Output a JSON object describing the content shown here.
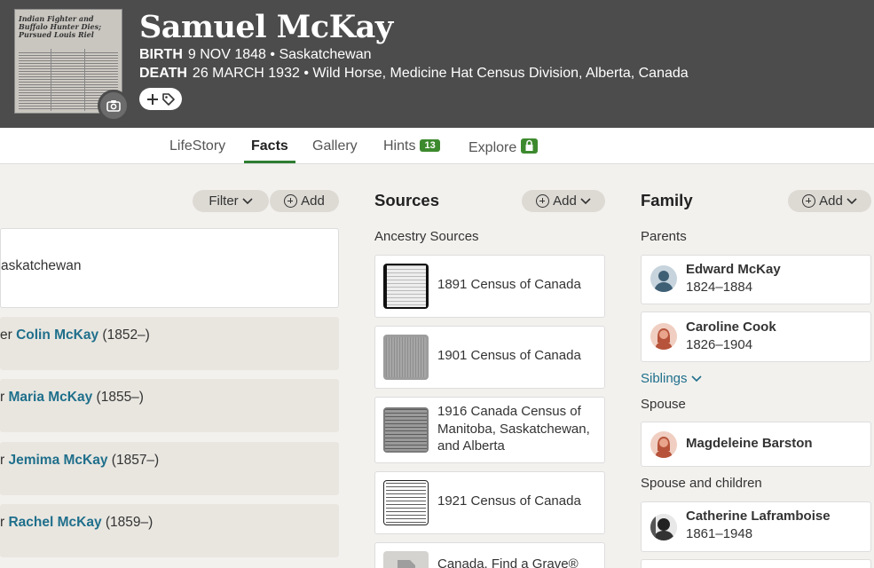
{
  "person": {
    "name": "Samuel McKay",
    "birth_label": "BIRTH",
    "birth_value": "9 NOV 1848 • Saskatchewan",
    "death_label": "DEATH",
    "death_value": "26 MARCH 1932 • Wild Horse, Medicine Hat Census Division, Alberta, Canada",
    "photo_headline": "Indian Fighter and Buffalo Hunter Dies; Pursued Louis Riel"
  },
  "tabs": [
    {
      "label": "LifeStory"
    },
    {
      "label": "Facts"
    },
    {
      "label": "Gallery"
    },
    {
      "label": "Hints",
      "badge": "13"
    },
    {
      "label": "Explore"
    }
  ],
  "facts": {
    "filter_label": "Filter",
    "add_label": "Add",
    "first_card_text": "askatchewan",
    "rows": [
      {
        "prefix": "er ",
        "name": "Colin McKay",
        "years": " (1852–)"
      },
      {
        "prefix": "r ",
        "name": "Maria McKay",
        "years": " (1855–)"
      },
      {
        "prefix": "r ",
        "name": "Jemima McKay",
        "years": " (1857–)"
      },
      {
        "prefix": "r ",
        "name": "Rachel McKay",
        "years": " (1859–)"
      }
    ]
  },
  "sources": {
    "title": "Sources",
    "add_label": "Add",
    "subheading": "Ancestry Sources",
    "items": [
      {
        "label": "1891 Census of Canada"
      },
      {
        "label": "1901 Census of Canada"
      },
      {
        "label": "1916 Canada Census of Manitoba, Saskatchewan, and Alberta"
      },
      {
        "label": "1921 Census of Canada"
      },
      {
        "label": "Canada, Find a Grave®"
      }
    ]
  },
  "family": {
    "title": "Family",
    "add_label": "Add",
    "parents_label": "Parents",
    "parents": [
      {
        "name": "Edward McKay",
        "dates": "1824–1884"
      },
      {
        "name": "Caroline Cook",
        "dates": "1826–1904"
      }
    ],
    "siblings_label": "Siblings",
    "spouse_label": "Spouse",
    "spouse": {
      "name": "Magdeleine Barston"
    },
    "spouse_children_label": "Spouse and children",
    "spouse2": {
      "name": "Catherine Laframboise",
      "dates": "1861–1948"
    }
  },
  "colors": {
    "header_bg": "#4c4c4c",
    "link": "#1f6f8b",
    "accent_green": "#3d8a2e",
    "page_bg": "#f3f1ee"
  },
  "icons": [
    "camera-icon",
    "plus-icon",
    "tag-icon",
    "chevron-down-icon",
    "circle-plus-icon",
    "lock-icon",
    "male-avatar-icon",
    "female-avatar-icon"
  ]
}
